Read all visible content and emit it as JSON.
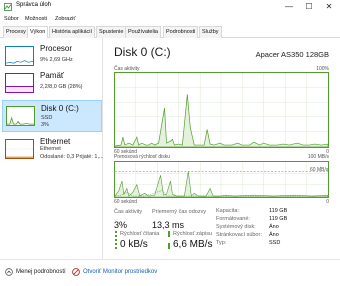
{
  "window": {
    "title": "Správca úloh",
    "minimize": "—",
    "maximize": "☐",
    "close": "✕"
  },
  "menu": [
    "Súbor",
    "Možnosti",
    "Zobraziť"
  ],
  "tabs": [
    "Procesy",
    "Výkon",
    "História aplikácií",
    "Spustenie",
    "Používatelia",
    "Podrobnosti",
    "Služby"
  ],
  "active_tab": "Výkon",
  "sidebar": {
    "items": [
      {
        "name": "Procesor",
        "line1": "9% 2,69 GHz",
        "line2": ""
      },
      {
        "name": "Pamäť",
        "line1": "2,2/8,0 GB (28%)",
        "line2": ""
      },
      {
        "name": "Disk 0 (C:)",
        "line1": "SSD",
        "line2": "3%"
      },
      {
        "name": "Ethernet",
        "line1": "Ethernet",
        "line2": "Odoslané: 0,3  Prijaté: 1,..."
      }
    ]
  },
  "main": {
    "title": "Disk 0 (C:)",
    "model": "Apacer AS350 128GB",
    "graph1": {
      "label": "Čas aktivity",
      "max": "100%",
      "time_left": "60 sekúnd",
      "time_right": "0"
    },
    "graph2": {
      "label": "Prenosová rýchlosť disku",
      "max": "100 MB/s",
      "scale": "60 MB/s",
      "time_left": "60 sekúnd",
      "time_right": "0"
    },
    "stats": {
      "active_time_label": "Čas aktivity",
      "active_time_value": "3%",
      "response_label": "Priemerný čas odozvy",
      "response_value": "13,3 ms",
      "read_label": "Rýchlosť čítania",
      "read_value": "0 kB/s",
      "write_label": "Rýchlosť zápisu",
      "write_value": "6,6 MB/s"
    },
    "properties": [
      {
        "label": "Kapacita:",
        "value": "119 GB"
      },
      {
        "label": "Formátované:",
        "value": "119 GB"
      },
      {
        "label": "Systémový disk:",
        "value": "Áno"
      },
      {
        "label": "Stránkovací súbor:",
        "value": "Áno"
      },
      {
        "label": "Typ:",
        "value": "SSD"
      }
    ]
  },
  "footer": {
    "fewer_details": "Menej podrobností",
    "open_monitor": "Otvoriť Monitor prostriedkov"
  },
  "colors": {
    "disk_green": "#4f9d2d",
    "cpu_blue": "#117dbb",
    "memory_purple": "#8b12ae",
    "ethernet_orange": "#a74f01",
    "selection": "#cce8ff"
  }
}
